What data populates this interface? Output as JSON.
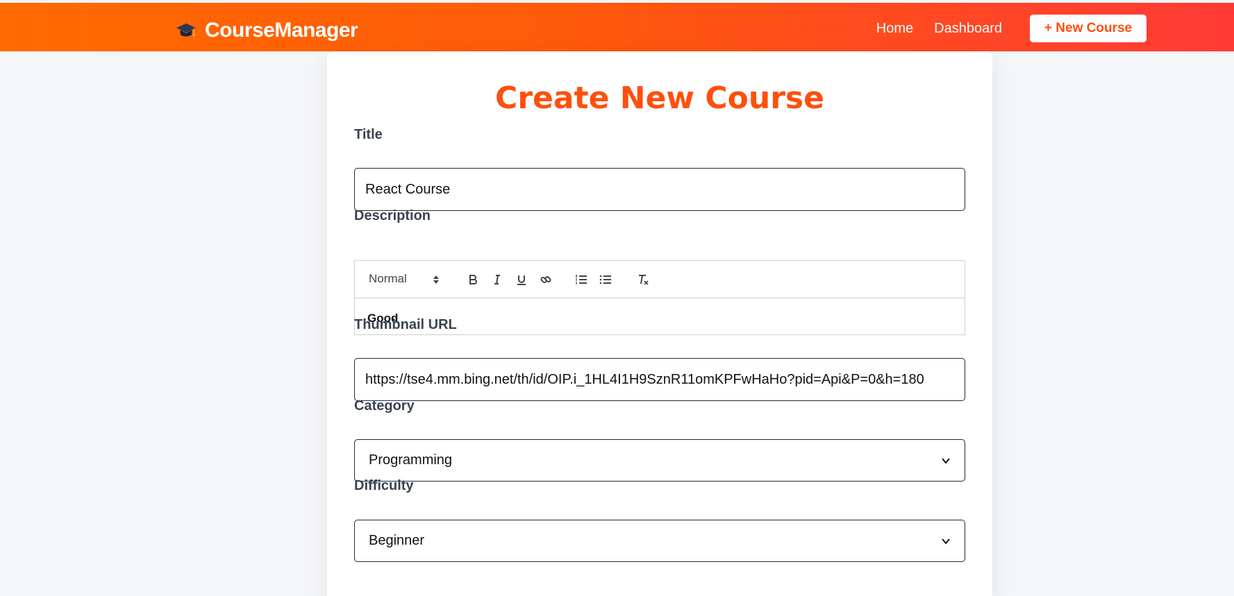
{
  "navbar": {
    "brand": "CourseManager",
    "home": "Home",
    "dashboard": "Dashboard",
    "new_course": "+ New Course"
  },
  "form": {
    "heading": "Create New Course",
    "title_label": "Title",
    "title_value": "React Course",
    "description_label": "Description",
    "editor": {
      "format": "Normal",
      "content": "Good"
    },
    "thumbnail_label": "Thumbnail URL",
    "thumbnail_value": "https://tse4.mm.bing.net/th/id/OIP.i_1HL4I1H9SznR11omKPFwHaHo?pid=Api&P=0&h=180",
    "category_label": "Category",
    "category_value": "Programming",
    "difficulty_label": "Difficulty",
    "difficulty_value": "Beginner"
  },
  "colors": {
    "accent": "#ff4f0c",
    "navbar_start": "#ff6a00",
    "navbar_end": "#ff3a36"
  }
}
